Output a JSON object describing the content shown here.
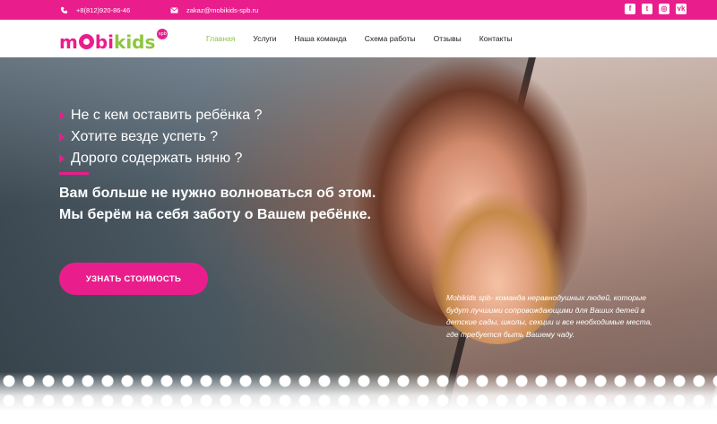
{
  "topbar": {
    "phone": "+8(812)920-86-46",
    "email": "zakaz@mobikids-spb.ru",
    "socials": [
      {
        "icon": "facebook-icon",
        "glyph": "f"
      },
      {
        "icon": "twitter-icon",
        "glyph": "t"
      },
      {
        "icon": "instagram-icon",
        "glyph": "◎"
      },
      {
        "icon": "vk-icon",
        "glyph": "vk"
      }
    ],
    "color": "#e91e8c"
  },
  "logo": {
    "m": "m",
    "bi": "bi",
    "kids": "kids",
    "badge": "spb"
  },
  "nav": {
    "items": [
      {
        "label": "Главная",
        "active": true
      },
      {
        "label": "Услуги",
        "active": false
      },
      {
        "label": "Наша команда",
        "active": false
      },
      {
        "label": "Схема работы",
        "active": false
      },
      {
        "label": "Отзывы",
        "active": false
      },
      {
        "label": "Контакты",
        "active": false
      }
    ],
    "active_color": "#8dc63f"
  },
  "hero": {
    "bullets": [
      "Не с кем оставить ребёнка ?",
      "Хотите везде успеть ?",
      "Дорого содержать няню ?"
    ],
    "headline_line1": "Вам больше не нужно волноваться об этом.",
    "headline_line2": "Мы берём на себя заботу о Вашем ребёнке.",
    "cta_label": "УЗНАТЬ СТОИМОСТЬ",
    "description": "Mobikids spb- команда неравнодушных людей, которые будут лучшими сопровождающими для Ваших детей в детские сады, школы, секции и все необходимые места, где требуется быть Вашему чаду."
  }
}
